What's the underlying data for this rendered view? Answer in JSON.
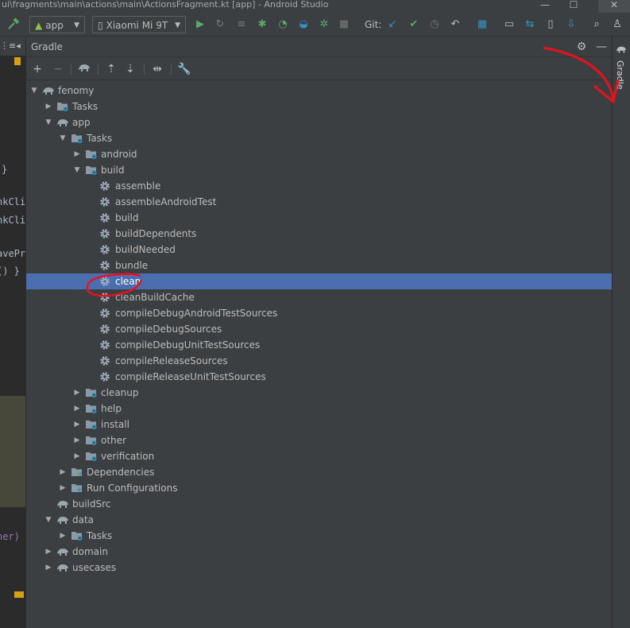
{
  "window": {
    "title": "ui\\fragments\\main\\actions\\main\\ActionsFragment.kt [app] - Android Studio",
    "minimize": "—",
    "maximize": "☐",
    "close": "✕"
  },
  "toolbar": {
    "config_label": "app",
    "device_label": "Xiaomi Mi 9T",
    "git_label": "Git:",
    "icons": [
      "hammer-icon",
      "run-icon",
      "apply-changes-icon",
      "debug-icon",
      "profile-icon",
      "attach-debugger-icon",
      "stop-icon",
      "git-update-icon",
      "git-commit-icon",
      "history-icon",
      "revert-icon",
      "project-structure-icon",
      "sdk-manager-icon",
      "avd-manager-icon",
      "search-icon",
      "user-icon"
    ]
  },
  "editor": {
    "fragments": [
      "}",
      "nkCli",
      "nkCli",
      "avePr",
      "() }",
      "her)"
    ]
  },
  "gradle_panel": {
    "title": "Gradle",
    "tools": [
      "+",
      "−",
      "⟳",
      "⇡",
      "⇣",
      "⇹",
      "⚙"
    ],
    "stripe_label": "Gradle",
    "selected": "clean"
  },
  "tree": [
    {
      "label": "fenomy",
      "indent": 0,
      "expanded": true,
      "icon": "gradle-project-icon"
    },
    {
      "label": "Tasks",
      "indent": 1,
      "expanded": false,
      "icon": "task-folder-icon"
    },
    {
      "label": "app",
      "indent": 1,
      "expanded": true,
      "icon": "gradle-module-icon"
    },
    {
      "label": "Tasks",
      "indent": 2,
      "expanded": true,
      "icon": "task-folder-icon"
    },
    {
      "label": "android",
      "indent": 3,
      "expanded": false,
      "icon": "task-folder-icon"
    },
    {
      "label": "build",
      "indent": 3,
      "expanded": true,
      "icon": "task-folder-icon"
    },
    {
      "label": "assemble",
      "indent": 4,
      "icon": "gear-icon"
    },
    {
      "label": "assembleAndroidTest",
      "indent": 4,
      "icon": "gear-icon"
    },
    {
      "label": "build",
      "indent": 4,
      "icon": "gear-icon"
    },
    {
      "label": "buildDependents",
      "indent": 4,
      "icon": "gear-icon"
    },
    {
      "label": "buildNeeded",
      "indent": 4,
      "icon": "gear-icon"
    },
    {
      "label": "bundle",
      "indent": 4,
      "icon": "gear-icon"
    },
    {
      "label": "clean",
      "indent": 4,
      "icon": "gear-icon",
      "selected": true
    },
    {
      "label": "cleanBuildCache",
      "indent": 4,
      "icon": "gear-icon"
    },
    {
      "label": "compileDebugAndroidTestSources",
      "indent": 4,
      "icon": "gear-icon"
    },
    {
      "label": "compileDebugSources",
      "indent": 4,
      "icon": "gear-icon"
    },
    {
      "label": "compileDebugUnitTestSources",
      "indent": 4,
      "icon": "gear-icon"
    },
    {
      "label": "compileReleaseSources",
      "indent": 4,
      "icon": "gear-icon"
    },
    {
      "label": "compileReleaseUnitTestSources",
      "indent": 4,
      "icon": "gear-icon"
    },
    {
      "label": "cleanup",
      "indent": 3,
      "expanded": false,
      "icon": "task-folder-icon"
    },
    {
      "label": "help",
      "indent": 3,
      "expanded": false,
      "icon": "task-folder-icon"
    },
    {
      "label": "install",
      "indent": 3,
      "expanded": false,
      "icon": "task-folder-icon"
    },
    {
      "label": "other",
      "indent": 3,
      "expanded": false,
      "icon": "task-folder-icon"
    },
    {
      "label": "verification",
      "indent": 3,
      "expanded": false,
      "icon": "task-folder-icon"
    },
    {
      "label": "Dependencies",
      "indent": 2,
      "expanded": false,
      "icon": "dependencies-icon"
    },
    {
      "label": "Run Configurations",
      "indent": 2,
      "expanded": false,
      "icon": "run-config-folder-icon"
    },
    {
      "label": "buildSrc",
      "indent": 1,
      "icon": "gradle-module-icon"
    },
    {
      "label": "data",
      "indent": 1,
      "expanded": true,
      "icon": "gradle-module-icon"
    },
    {
      "label": "Tasks",
      "indent": 2,
      "expanded": false,
      "icon": "task-folder-icon"
    },
    {
      "label": "domain",
      "indent": 1,
      "expanded": false,
      "icon": "gradle-module-icon"
    },
    {
      "label": "usecases",
      "indent": 1,
      "expanded": false,
      "icon": "gradle-module-icon"
    }
  ],
  "colors": {
    "background": "#3c3f41",
    "selection": "#4b6eaf",
    "annotation": "#e8121f",
    "run_green": "#59a869",
    "icon_blue": "#3592c4"
  }
}
